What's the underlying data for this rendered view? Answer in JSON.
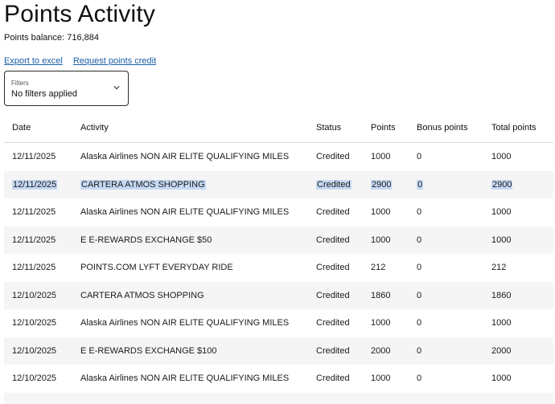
{
  "page": {
    "title": "Points Activity",
    "balance": "Points balance: 716,884"
  },
  "links": {
    "export": "Export to excel",
    "request_credit": "Request points credit"
  },
  "filter": {
    "label": "Filters",
    "value": "No filters applied",
    "icon": "chevron-down-icon"
  },
  "table": {
    "headers": {
      "date": "Date",
      "activity": "Activity",
      "status": "Status",
      "points": "Points",
      "bonus": "Bonus points",
      "total": "Total points"
    },
    "rows": [
      {
        "date": "12/11/2025",
        "activity": "Alaska Airlines NON AIR ELITE QUALIFYING MILES",
        "status": "Credited",
        "points": "1000",
        "bonus": "0",
        "total": "1000"
      },
      {
        "date": "12/11/2025",
        "activity": "CARTERA ATMOS SHOPPING",
        "status": "Credited",
        "points": "2900",
        "bonus": "0",
        "total": "2900"
      },
      {
        "date": "12/11/2025",
        "activity": "Alaska Airlines NON AIR ELITE QUALIFYING MILES",
        "status": "Credited",
        "points": "1000",
        "bonus": "0",
        "total": "1000"
      },
      {
        "date": "12/11/2025",
        "activity": "E E-REWARDS EXCHANGE $50",
        "status": "Credited",
        "points": "1000",
        "bonus": "0",
        "total": "1000"
      },
      {
        "date": "12/11/2025",
        "activity": "POINTS.COM LYFT EVERYDAY RIDE",
        "status": "Credited",
        "points": "212",
        "bonus": "0",
        "total": "212"
      },
      {
        "date": "12/10/2025",
        "activity": "CARTERA ATMOS SHOPPING",
        "status": "Credited",
        "points": "1860",
        "bonus": "0",
        "total": "1860"
      },
      {
        "date": "12/10/2025",
        "activity": "Alaska Airlines NON AIR ELITE QUALIFYING MILES",
        "status": "Credited",
        "points": "1000",
        "bonus": "0",
        "total": "1000"
      },
      {
        "date": "12/10/2025",
        "activity": "E E-REWARDS EXCHANGE $100",
        "status": "Credited",
        "points": "2000",
        "bonus": "0",
        "total": "2000"
      },
      {
        "date": "12/10/2025",
        "activity": "Alaska Airlines NON AIR ELITE QUALIFYING MILES",
        "status": "Credited",
        "points": "1000",
        "bonus": "0",
        "total": "1000"
      }
    ]
  },
  "colors": {
    "link": "#1b5faa",
    "row_alt": "#f5f5f5",
    "selection": "#c5d9f3"
  }
}
